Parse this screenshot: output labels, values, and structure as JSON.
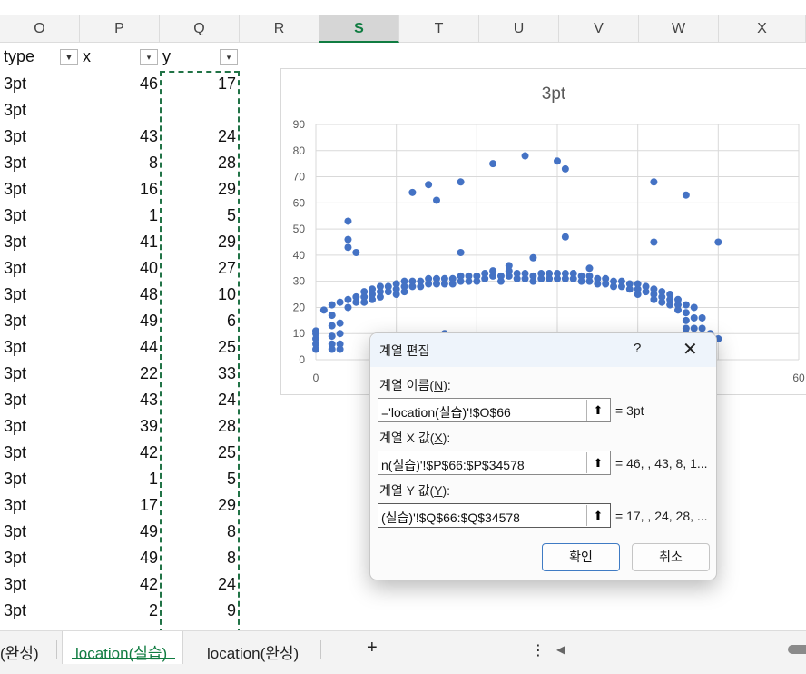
{
  "columns": [
    "O",
    "P",
    "Q",
    "R",
    "S",
    "T",
    "U",
    "V",
    "W",
    "X"
  ],
  "selected_column": "S",
  "table": {
    "headers": [
      "type",
      "x",
      "y"
    ],
    "rows": [
      [
        "3pt",
        "46",
        "17"
      ],
      [
        "3pt",
        "",
        ""
      ],
      [
        "3pt",
        "43",
        "24"
      ],
      [
        "3pt",
        "8",
        "28"
      ],
      [
        "3pt",
        "16",
        "29"
      ],
      [
        "3pt",
        "1",
        "5"
      ],
      [
        "3pt",
        "41",
        "29"
      ],
      [
        "3pt",
        "40",
        "27"
      ],
      [
        "3pt",
        "48",
        "10"
      ],
      [
        "3pt",
        "49",
        "6"
      ],
      [
        "3pt",
        "44",
        "25"
      ],
      [
        "3pt",
        "22",
        "33"
      ],
      [
        "3pt",
        "43",
        "24"
      ],
      [
        "3pt",
        "39",
        "28"
      ],
      [
        "3pt",
        "42",
        "25"
      ],
      [
        "3pt",
        "1",
        "5"
      ],
      [
        "3pt",
        "17",
        "29"
      ],
      [
        "3pt",
        "49",
        "8"
      ],
      [
        "3pt",
        "49",
        "8"
      ],
      [
        "3pt",
        "42",
        "24"
      ],
      [
        "3pt",
        "2",
        "9"
      ]
    ]
  },
  "chart_data": {
    "type": "scatter",
    "title": "3pt",
    "xlim": [
      0,
      60
    ],
    "ylim": [
      0,
      90
    ],
    "xticks": [
      0,
      60
    ],
    "yticks": [
      0,
      10,
      20,
      30,
      40,
      50,
      60,
      70,
      80,
      90
    ],
    "grid": true,
    "color": "#4472c4",
    "series": [
      {
        "name": "3pt",
        "points": [
          [
            0,
            10
          ],
          [
            0,
            8
          ],
          [
            0,
            6
          ],
          [
            0,
            4
          ],
          [
            0,
            11
          ],
          [
            1,
            19
          ],
          [
            2,
            21
          ],
          [
            2,
            17
          ],
          [
            2,
            13
          ],
          [
            2,
            9
          ],
          [
            2,
            6
          ],
          [
            2,
            4
          ],
          [
            3,
            22
          ],
          [
            3,
            14
          ],
          [
            3,
            10
          ],
          [
            3,
            6
          ],
          [
            3,
            4
          ],
          [
            4,
            20
          ],
          [
            4,
            23
          ],
          [
            5,
            24
          ],
          [
            5,
            22
          ],
          [
            6,
            26
          ],
          [
            6,
            24
          ],
          [
            6,
            22
          ],
          [
            7,
            27
          ],
          [
            7,
            25
          ],
          [
            7,
            23
          ],
          [
            8,
            28
          ],
          [
            8,
            26
          ],
          [
            8,
            24
          ],
          [
            9,
            28
          ],
          [
            9,
            26
          ],
          [
            10,
            29
          ],
          [
            10,
            27
          ],
          [
            10,
            25
          ],
          [
            11,
            30
          ],
          [
            11,
            28
          ],
          [
            11,
            26
          ],
          [
            12,
            30
          ],
          [
            12,
            28
          ],
          [
            13,
            30
          ],
          [
            13,
            28
          ],
          [
            14,
            31
          ],
          [
            14,
            29
          ],
          [
            15,
            31
          ],
          [
            15,
            29
          ],
          [
            16,
            31
          ],
          [
            16,
            29
          ],
          [
            17,
            31
          ],
          [
            17,
            29
          ],
          [
            18,
            32
          ],
          [
            18,
            30
          ],
          [
            19,
            32
          ],
          [
            19,
            30
          ],
          [
            20,
            32
          ],
          [
            20,
            30
          ],
          [
            21,
            33
          ],
          [
            21,
            31
          ],
          [
            22,
            34
          ],
          [
            22,
            32
          ],
          [
            23,
            32
          ],
          [
            23,
            30
          ],
          [
            24,
            34
          ],
          [
            24,
            32
          ],
          [
            25,
            33
          ],
          [
            25,
            31
          ],
          [
            26,
            33
          ],
          [
            26,
            31
          ],
          [
            27,
            32
          ],
          [
            27,
            30
          ],
          [
            28,
            33
          ],
          [
            28,
            31
          ],
          [
            29,
            33
          ],
          [
            29,
            31
          ],
          [
            30,
            33
          ],
          [
            30,
            31
          ],
          [
            31,
            33
          ],
          [
            31,
            31
          ],
          [
            32,
            33
          ],
          [
            32,
            31
          ],
          [
            33,
            32
          ],
          [
            33,
            30
          ],
          [
            34,
            32
          ],
          [
            34,
            30
          ],
          [
            35,
            31
          ],
          [
            35,
            29
          ],
          [
            36,
            31
          ],
          [
            36,
            29
          ],
          [
            37,
            30
          ],
          [
            37,
            28
          ],
          [
            38,
            30
          ],
          [
            38,
            28
          ],
          [
            39,
            29
          ],
          [
            39,
            27
          ],
          [
            40,
            29
          ],
          [
            40,
            27
          ],
          [
            40,
            25
          ],
          [
            41,
            28
          ],
          [
            41,
            26
          ],
          [
            42,
            27
          ],
          [
            42,
            25
          ],
          [
            42,
            23
          ],
          [
            43,
            26
          ],
          [
            43,
            24
          ],
          [
            43,
            22
          ],
          [
            44,
            25
          ],
          [
            44,
            23
          ],
          [
            44,
            21
          ],
          [
            45,
            23
          ],
          [
            45,
            21
          ],
          [
            45,
            19
          ],
          [
            46,
            21
          ],
          [
            46,
            18
          ],
          [
            46,
            15
          ],
          [
            46,
            12
          ],
          [
            46,
            10
          ],
          [
            47,
            20
          ],
          [
            47,
            16
          ],
          [
            47,
            12
          ],
          [
            48,
            16
          ],
          [
            48,
            12
          ],
          [
            48,
            9
          ],
          [
            49,
            10
          ],
          [
            49,
            8
          ],
          [
            49,
            6
          ],
          [
            50,
            8
          ],
          [
            12,
            64
          ],
          [
            14,
            67
          ],
          [
            15,
            61
          ],
          [
            18,
            68
          ],
          [
            22,
            75
          ],
          [
            26,
            78
          ],
          [
            30,
            76
          ],
          [
            31,
            73
          ],
          [
            31,
            47
          ],
          [
            27,
            39
          ],
          [
            42,
            68
          ],
          [
            42,
            45
          ],
          [
            46,
            63
          ],
          [
            50,
            45
          ],
          [
            4,
            53
          ],
          [
            4,
            46
          ],
          [
            4,
            43
          ],
          [
            5,
            41
          ],
          [
            18,
            41
          ],
          [
            34,
            35
          ],
          [
            24,
            36
          ],
          [
            16,
            10
          ]
        ]
      }
    ]
  },
  "dialog": {
    "title": "계열 편집",
    "help": "?",
    "close": "✕",
    "name_label": "계열 이름(",
    "name_key": "N",
    "name_value": "='location(실습)'!$O$66",
    "name_preview": "= 3pt",
    "x_label": "계열 X 값(",
    "x_key": "X",
    "x_value": "n(실습)'!$P$66:$P$34578",
    "x_preview": "= 46, , 43, 8, 1...",
    "y_label": "계열 Y 값(",
    "y_key": "Y",
    "y_value": "(실습)'!$Q$66:$Q$34578",
    "y_preview": "= 17, , 24, 28, ...",
    "ok": "확인",
    "cancel": "취소"
  },
  "tabs": {
    "left_partial": "(완성)",
    "active": "location(실습)",
    "next": "location(완성)",
    "add": "+",
    "more": "⋮",
    "scroll_left": "◀"
  }
}
